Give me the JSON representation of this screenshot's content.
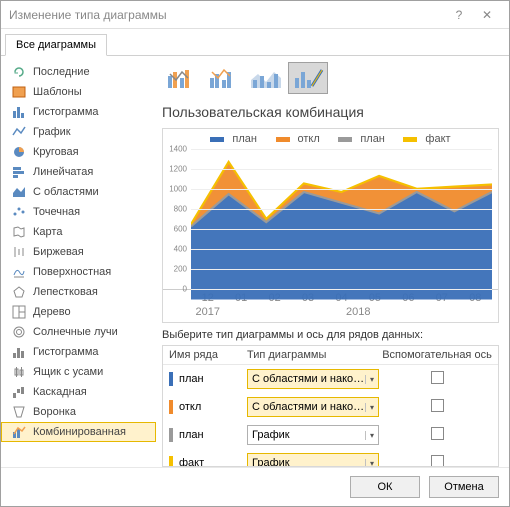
{
  "dialog": {
    "title": "Изменение типа диаграммы"
  },
  "tabs": {
    "active": "Все диаграммы"
  },
  "sidebar": {
    "items": [
      {
        "label": "Последние",
        "icon": "recent"
      },
      {
        "label": "Шаблоны",
        "icon": "templates"
      },
      {
        "label": "Гистограмма",
        "icon": "column"
      },
      {
        "label": "График",
        "icon": "line"
      },
      {
        "label": "Круговая",
        "icon": "pie"
      },
      {
        "label": "Линейчатая",
        "icon": "bar"
      },
      {
        "label": "С областями",
        "icon": "area"
      },
      {
        "label": "Точечная",
        "icon": "scatter"
      },
      {
        "label": "Карта",
        "icon": "map"
      },
      {
        "label": "Биржевая",
        "icon": "stock"
      },
      {
        "label": "Поверхностная",
        "icon": "surface"
      },
      {
        "label": "Лепестковая",
        "icon": "radar"
      },
      {
        "label": "Дерево",
        "icon": "treemap"
      },
      {
        "label": "Солнечные лучи",
        "icon": "sunburst"
      },
      {
        "label": "Гистограмма",
        "icon": "histogram"
      },
      {
        "label": "Ящик с усами",
        "icon": "boxwhisker"
      },
      {
        "label": "Каскадная",
        "icon": "waterfall"
      },
      {
        "label": "Воронка",
        "icon": "funnel"
      },
      {
        "label": "Комбинированная",
        "icon": "combo",
        "selected": true
      }
    ]
  },
  "main": {
    "title": "Пользовательская комбинация",
    "series_label": "Выберите тип диаграммы и ось для рядов данных:",
    "headers": {
      "name": "Имя ряда",
      "type": "Тип диаграммы",
      "aux": "Вспомогательная ось"
    },
    "series": [
      {
        "name": "план",
        "color": "#3a6fb7",
        "type": "С областями и нако…",
        "hl": true,
        "aux": false
      },
      {
        "name": "откл",
        "color": "#f08b2c",
        "type": "С областями и нако…",
        "hl": true,
        "aux": false
      },
      {
        "name": "план",
        "color": "#9a9a9a",
        "type": "График",
        "hl": false,
        "aux": false
      },
      {
        "name": "факт",
        "color": "#f5c000",
        "type": "График",
        "hl": true,
        "aux": false
      }
    ]
  },
  "chart_data": {
    "type": "area",
    "title": "",
    "xlabel": "",
    "ylabel": "",
    "ylim": [
      0,
      1400
    ],
    "yticks": [
      0,
      200,
      400,
      600,
      800,
      1000,
      1200,
      1400
    ],
    "categories": [
      "12",
      "01",
      "02",
      "03",
      "04",
      "05",
      "06",
      "07",
      "08"
    ],
    "year_groups": [
      {
        "label": "2017",
        "span": 1
      },
      {
        "label": "2018",
        "span": 8
      }
    ],
    "series": [
      {
        "name": "план",
        "color": "#3a6fb7",
        "type": "area_stacked",
        "values": [
          680,
          980,
          720,
          1000,
          900,
          800,
          1000,
          820,
          1000
        ]
      },
      {
        "name": "откл",
        "color": "#f08b2c",
        "type": "area_stacked",
        "values": [
          20,
          300,
          30,
          80,
          100,
          350,
          30,
          230,
          70
        ]
      },
      {
        "name": "план",
        "color": "#9a9a9a",
        "type": "line",
        "values": [
          680,
          980,
          720,
          1000,
          900,
          800,
          1000,
          820,
          1000
        ]
      },
      {
        "name": "факт",
        "color": "#f5c000",
        "type": "line",
        "values": [
          700,
          1280,
          750,
          1080,
          1000,
          1150,
          1030,
          1050,
          1070
        ]
      }
    ],
    "legend": [
      "план",
      "откл",
      "план",
      "факт"
    ]
  },
  "colors": {
    "plan": "#3a6fb7",
    "otkl": "#f08b2c",
    "plan2": "#9a9a9a",
    "fact": "#f5c000"
  },
  "footer": {
    "ok": "ОК",
    "cancel": "Отмена"
  }
}
